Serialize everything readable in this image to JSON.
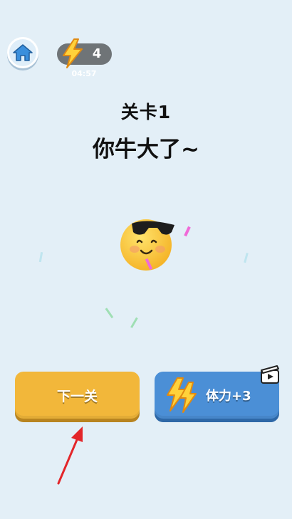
{
  "header": {
    "home_icon": "home-icon",
    "energy_icon": "lightning-bolt-icon",
    "energy_count": "4",
    "energy_timer": "04:57"
  },
  "level": {
    "title": "关卡1",
    "praise": "你牛大了~"
  },
  "character": {
    "icon": "cool-sunglasses-emoji"
  },
  "buttons": {
    "next_label": "下一关",
    "energy_label": "体力+3",
    "energy_icon": "lightning-bolt-icon",
    "video_icon": "video-ad-icon"
  },
  "colors": {
    "background": "#e3eff7",
    "next_button": "#f2b73a",
    "energy_button": "#4b8fd6",
    "bolt": "#ffd23a",
    "arrow": "#e3262a"
  }
}
